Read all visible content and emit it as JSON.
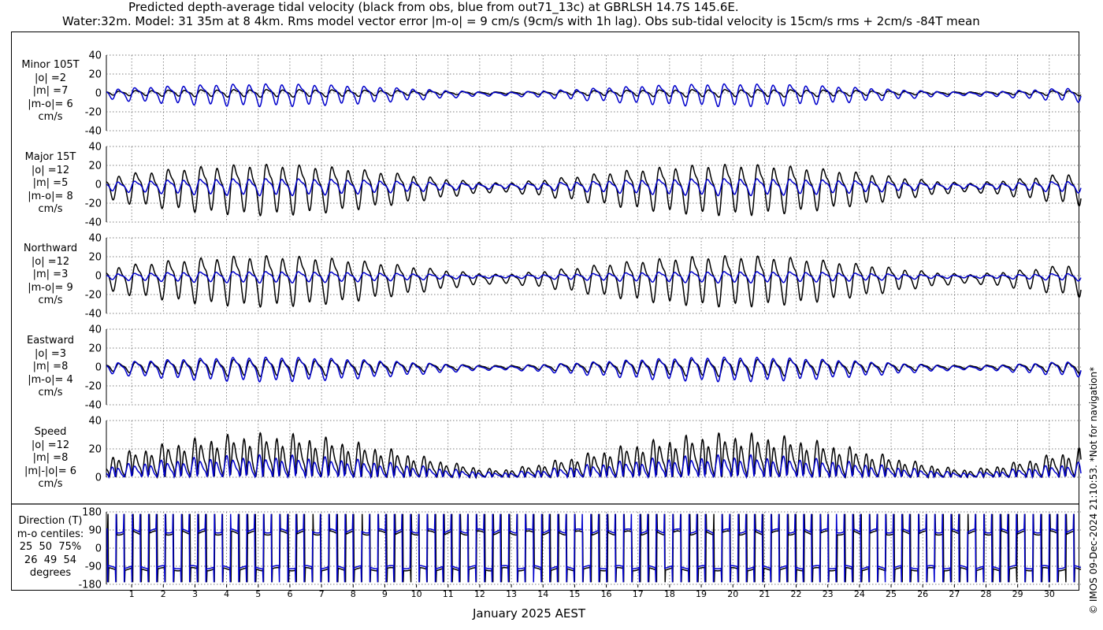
{
  "titles": {
    "line1": "Predicted depth-average tidal velocity (black from obs, blue from out71_13c) at GBRLSH 14.7S 145.6E.",
    "line2": "Water:32m. Model: 31 35m at 8 4km. Rms model vector error |m-o| = 9 cm/s (9cm/s with 1h lag). Obs sub-tidal velocity is 15cm/s rms + 2cm/s -84T mean"
  },
  "watermark": "© IMOS 09-Dec-2024 21:10:53. *Not for navigation*",
  "colors": {
    "obs": "#000000",
    "model": "#0000cc",
    "grid": "#555555"
  },
  "chart_data": {
    "type": "line",
    "xlabel": "January 2025 AEST",
    "xticks": [
      "1",
      "2",
      "3",
      "4",
      "5",
      "6",
      "7",
      "8",
      "9",
      "10",
      "11",
      "12",
      "13",
      "14",
      "15",
      "16",
      "17",
      "18",
      "19",
      "20",
      "21",
      "22",
      "23",
      "24",
      "25",
      "26",
      "27",
      "28",
      "29",
      "30"
    ],
    "xlim": [
      0.2,
      31.0
    ],
    "panels": [
      {
        "id": "minor",
        "label": "Minor 105T\n|o| =2\n|m| =7\n|m-o|= 6\ncm/s",
        "ylim": [
          -40,
          40
        ],
        "yticks": [
          -40,
          -20,
          0,
          20,
          40
        ],
        "series": [
          {
            "key": "obs",
            "amp_neap": 1,
            "amp_spring": 4,
            "mean": 0
          },
          {
            "key": "model",
            "amp_neap": 1,
            "amp_spring": 12,
            "mean": -1
          }
        ]
      },
      {
        "id": "major",
        "label": "Major 15T\n|o| =12\n|m| =5\n|m-o|= 8\ncm/s",
        "ylim": [
          -40,
          40
        ],
        "yticks": [
          -40,
          -20,
          0,
          20,
          40
        ],
        "series": [
          {
            "key": "obs",
            "amp_neap": 3,
            "amp_spring": 27,
            "mean": -3
          },
          {
            "key": "model",
            "amp_neap": 2,
            "amp_spring": 9,
            "mean": -2
          }
        ]
      },
      {
        "id": "north",
        "label": "Northward\n|o| =12\n|m| =3\n|m-o|= 9\ncm/s",
        "ylim": [
          -40,
          40
        ],
        "yticks": [
          -40,
          -20,
          0,
          20,
          40
        ],
        "series": [
          {
            "key": "obs",
            "amp_neap": 3,
            "amp_spring": 27,
            "mean": -3
          },
          {
            "key": "model",
            "amp_neap": 1,
            "amp_spring": 6,
            "mean": -1
          }
        ]
      },
      {
        "id": "east",
        "label": "Eastward\n|o| =3\n|m| =8\n|m-o|= 4\ncm/s",
        "ylim": [
          -40,
          40
        ],
        "yticks": [
          -40,
          -20,
          0,
          20,
          40
        ],
        "series": [
          {
            "key": "obs",
            "amp_neap": 1,
            "amp_spring": 9,
            "mean": 0
          },
          {
            "key": "model",
            "amp_neap": 1,
            "amp_spring": 13,
            "mean": -1
          }
        ]
      },
      {
        "id": "speed",
        "label": "Speed\n|o| =12\n|m| =8\n|m|-|o|= 6\ncm/s",
        "ylim": [
          0,
          40
        ],
        "yticks": [
          0,
          20,
          40
        ],
        "series": [
          {
            "key": "obs",
            "amp_neap": 3,
            "amp_spring": 28,
            "mean": 0
          },
          {
            "key": "model",
            "amp_neap": 2,
            "amp_spring": 14,
            "mean": 0
          }
        ]
      },
      {
        "id": "direction",
        "label": "Direction (T)\nm-o centiles:\n25  50  75%\n26  49  54\ndegrees",
        "ylim": [
          -180,
          180
        ],
        "yticks": [
          -180,
          -90,
          0,
          90,
          180
        ],
        "series": [
          {
            "key": "obs",
            "high": 75,
            "low": -105
          },
          {
            "key": "model",
            "high": 85,
            "low": -95
          }
        ]
      }
    ]
  }
}
